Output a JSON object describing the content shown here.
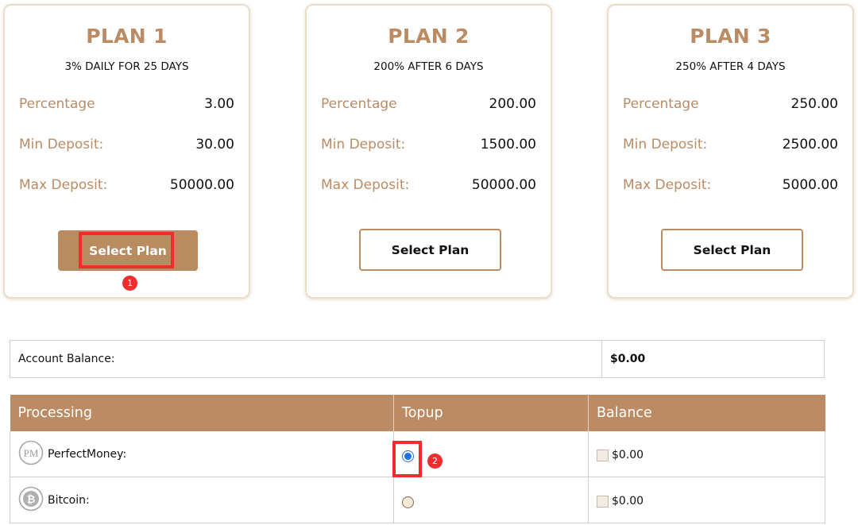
{
  "plans": [
    {
      "title": "PLAN 1",
      "subtitle": "3% DAILY FOR 25 DAYS",
      "rows": [
        {
          "label": "Percentage",
          "value": "3.00"
        },
        {
          "label": "Min Deposit:",
          "value": "30.00"
        },
        {
          "label": "Max Deposit:",
          "value": "50000.00"
        }
      ],
      "button_label": "Select Plan",
      "selected": true
    },
    {
      "title": "PLAN 2",
      "subtitle": "200% AFTER 6 DAYS",
      "rows": [
        {
          "label": "Percentage",
          "value": "200.00"
        },
        {
          "label": "Min Deposit:",
          "value": "1500.00"
        },
        {
          "label": "Max Deposit:",
          "value": "50000.00"
        }
      ],
      "button_label": "Select Plan",
      "selected": false
    },
    {
      "title": "PLAN 3",
      "subtitle": "250% AFTER 4 DAYS",
      "rows": [
        {
          "label": "Percentage",
          "value": "250.00"
        },
        {
          "label": "Min Deposit:",
          "value": "2500.00"
        },
        {
          "label": "Max Deposit:",
          "value": "5000.00"
        }
      ],
      "button_label": "Select Plan",
      "selected": false
    }
  ],
  "account": {
    "label": "Account Balance:",
    "value": "$0.00"
  },
  "processing_table": {
    "headers": [
      "Processing",
      "Topup",
      "Balance"
    ],
    "rows": [
      {
        "name": "PerfectMoney:",
        "icon": "perfectmoney-logo-icon",
        "topup_selected": true,
        "balance": "$0.00"
      },
      {
        "name": "Bitcoin:",
        "icon": "bitcoin-logo-icon",
        "topup_selected": false,
        "balance": "$0.00"
      }
    ]
  },
  "annotations": [
    "1",
    "2"
  ],
  "colors": {
    "accent": "#bb8c63",
    "annotation": "#ef2d2d",
    "radio_selected": "#1a73e8"
  }
}
